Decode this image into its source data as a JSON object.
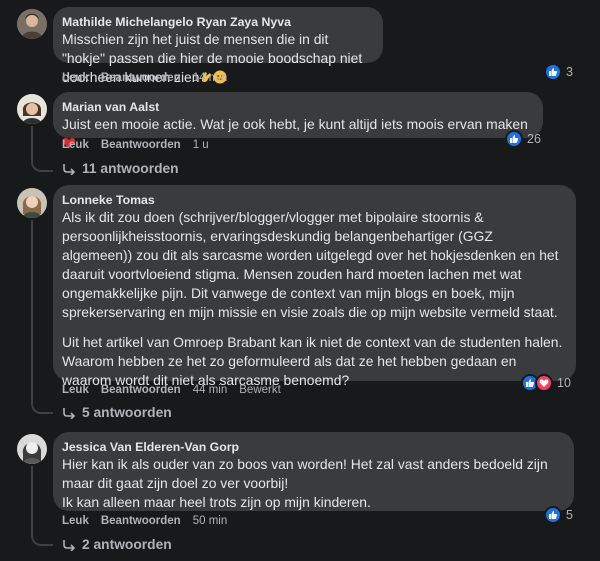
{
  "comments": [
    {
      "author": "Mathilde Michelangelo Ryan Zaya Nyva",
      "text": "Misschien zijn het juist de mensen die in dit \"hokje\" passen die hier de mooie boodschap niet doorheen kunnen zien",
      "like": "Leuk",
      "reply": "Beantwoorden",
      "time": "14 min",
      "reaction_count": "3"
    },
    {
      "author": "Marian van Aalst",
      "text": "Juist een mooie actie. Wat je ook hebt, je kunt altijd iets moois ervan maken",
      "like": "Leuk",
      "reply": "Beantwoorden",
      "time": "1 u",
      "reaction_count": "26",
      "replies": "11 antwoorden"
    },
    {
      "author": "Lonneke Tomas",
      "text1": "Als ik dit zou doen (schrijver/blogger/vlogger met bipolaire stoornis & persoonlijkheisstoornis, ervaringsdeskundig belangenbehartiger (GGZ algemeen)) zou dit als sarcasme worden uitgelegd over het hokjesdenken en het daaruit voortvloeiend stigma. Mensen zouden hard moeten lachen met wat ongemakkelijke pijn. Dit vanwege de context van mijn blogs en boek, mijn sprekerservaring en mijn missie en visie zoals die op mijn website vermeld staat.",
      "text2": "Uit het artikel van Omroep Brabant kan ik niet de context van de studenten halen. Waarom hebben ze het zo geformuleerd als dat ze het hebben gedaan en waarom wordt dit niet als sarcasme benoemd?",
      "like": "Leuk",
      "reply": "Beantwoorden",
      "time": "44 min",
      "edited": "Bewerkt",
      "reaction_count": "10",
      "replies": "5 antwoorden"
    },
    {
      "author": "Jessica Van Elderen-Van Gorp",
      "text": "Hier kan ik als ouder van zo boos van worden! Het zal vast anders bedoeld zijn maar dit gaat zijn doel zo ver voorbij!\nIk kan alleen maar heel trots zijn op mijn kinderen.",
      "like": "Leuk",
      "reply": "Beantwoorden",
      "time": "50 min",
      "reaction_count": "5",
      "replies": "2 antwoorden"
    }
  ],
  "colors": {
    "background": "#18191a",
    "bubble": "#3a3b3c",
    "like_blue": "#1b74e4",
    "heart_red": "#f3425f",
    "secondary_text": "#b0b3b8"
  },
  "icons": [
    "like-icon",
    "heart-icon",
    "reply-arrow-icon",
    "clap-emoji",
    "smile-emoji",
    "red-heart-emoji"
  ]
}
